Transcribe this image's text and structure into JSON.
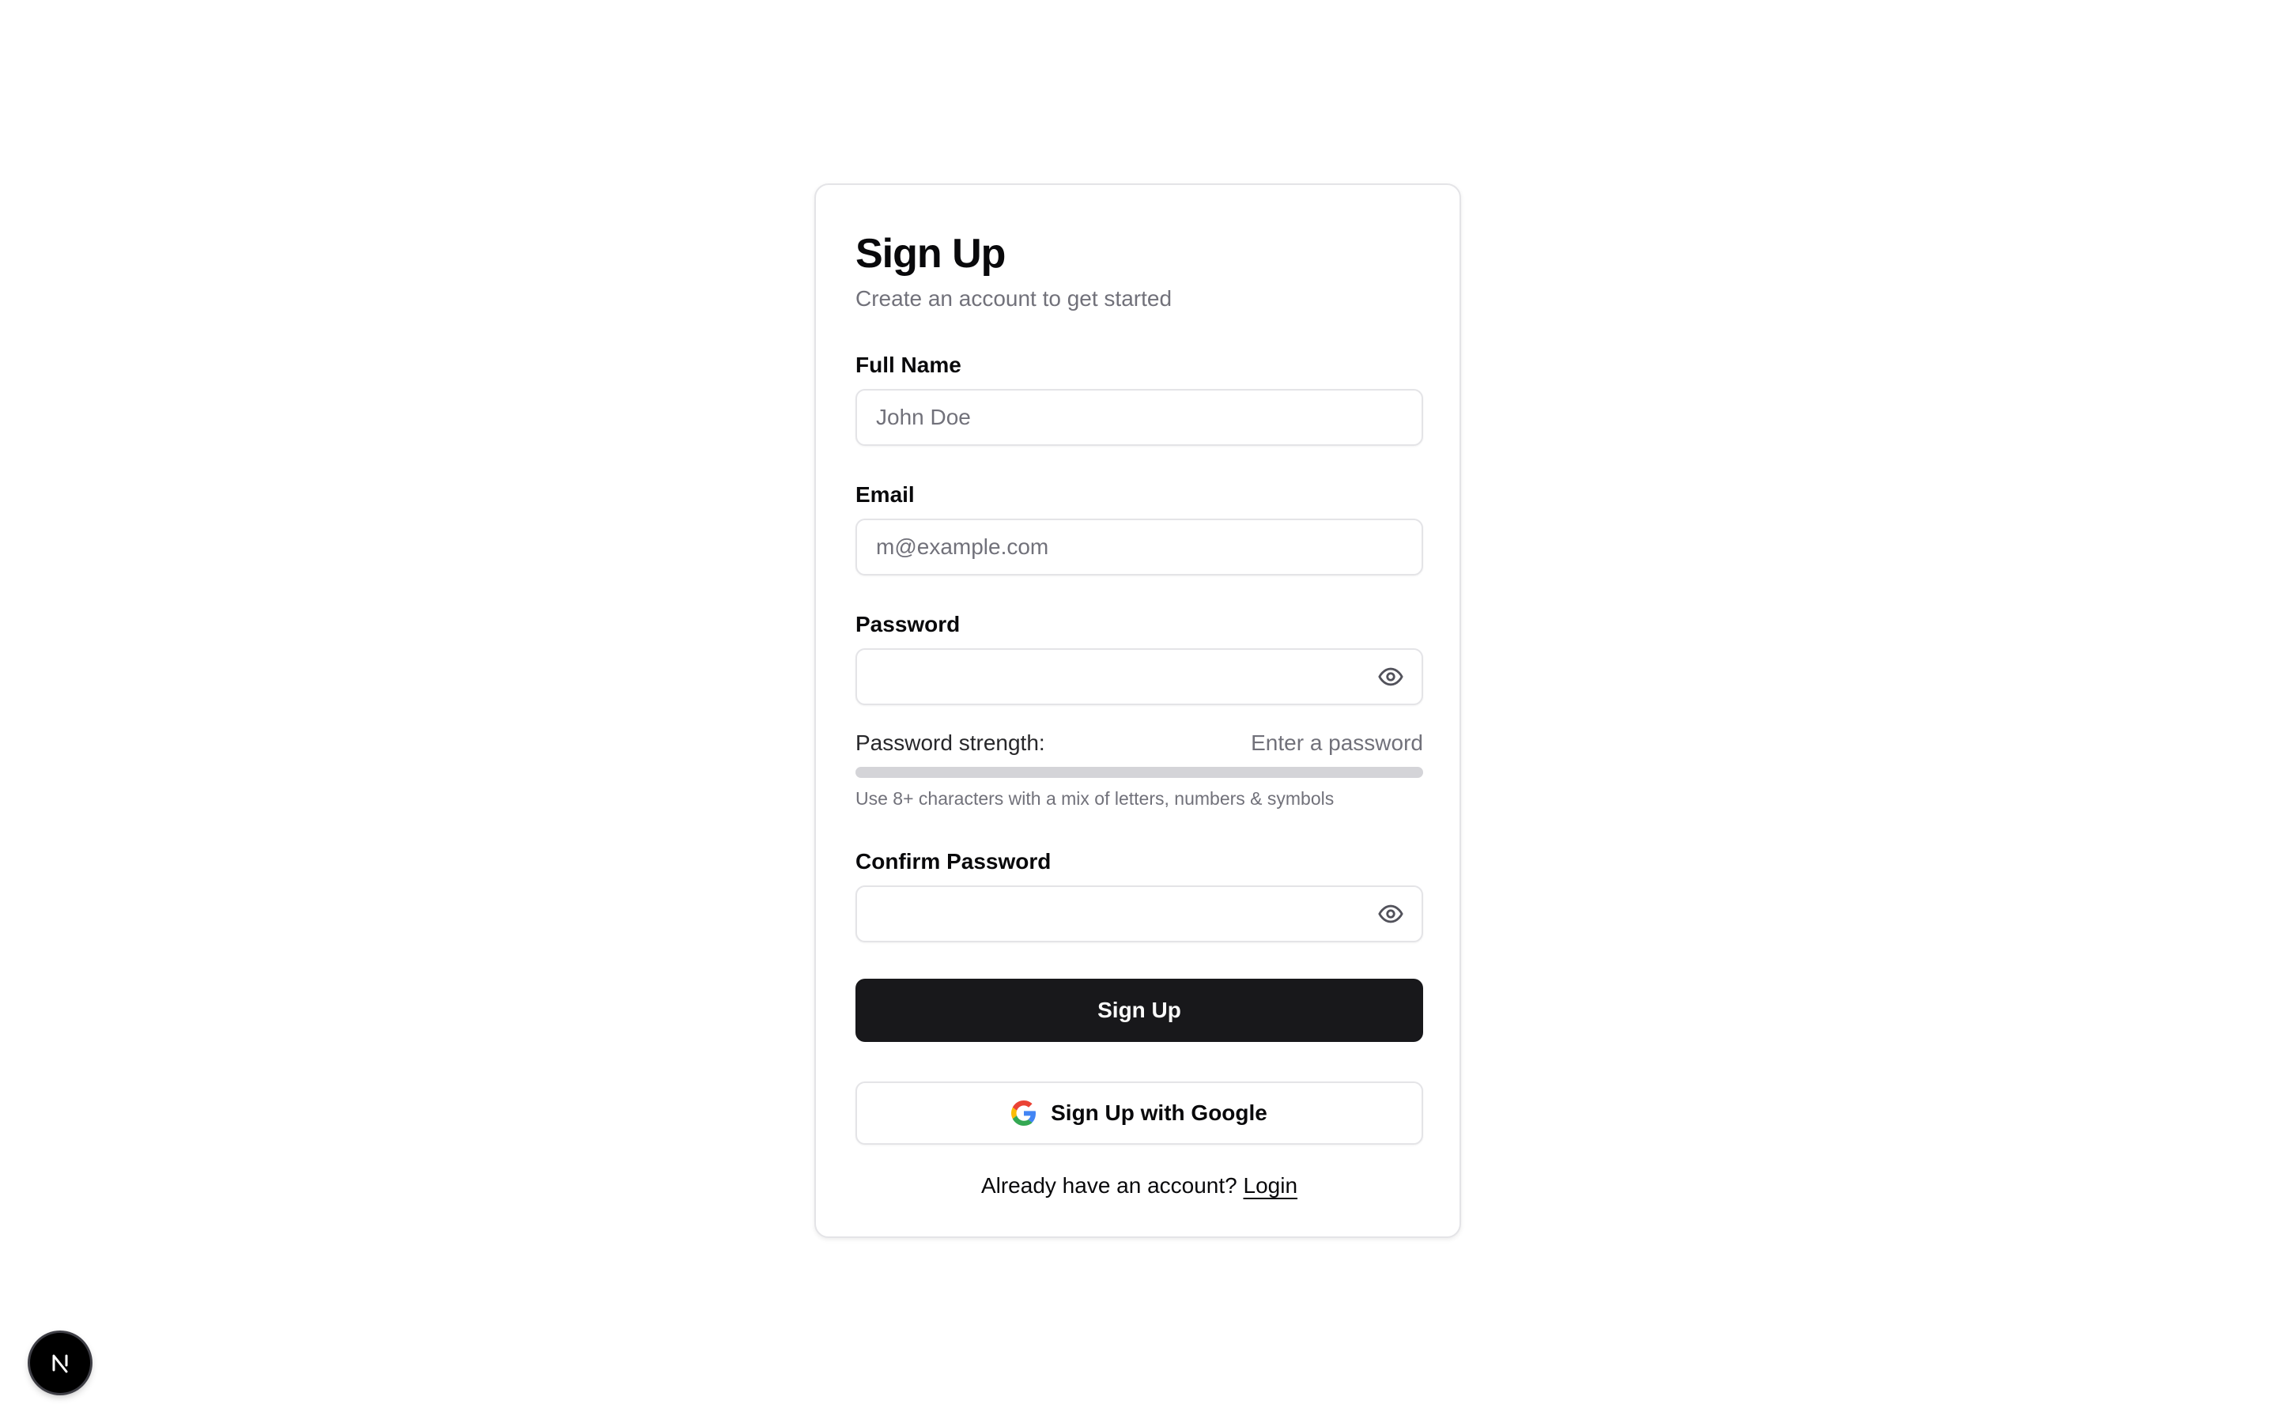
{
  "form": {
    "title": "Sign Up",
    "subtitle": "Create an account to get started",
    "full_name": {
      "label": "Full Name",
      "placeholder": "John Doe",
      "value": ""
    },
    "email": {
      "label": "Email",
      "placeholder": "m@example.com",
      "value": ""
    },
    "password": {
      "label": "Password",
      "placeholder": "",
      "value": "",
      "toggle_icon": "eye-icon"
    },
    "strength": {
      "label": "Password strength:",
      "status": "Enter a password",
      "level": 0,
      "hint": "Use 8+ characters with a mix of letters, numbers & symbols"
    },
    "confirm_password": {
      "label": "Confirm Password",
      "placeholder": "",
      "value": "",
      "toggle_icon": "eye-icon"
    },
    "submit_label": "Sign Up",
    "google_label": "Sign Up with Google",
    "login_prompt": "Already have an account?",
    "login_link": "Login"
  },
  "dev_badge": {
    "icon": "nextjs-logo-icon",
    "letter": "N"
  },
  "colors": {
    "primary_button": "#18181b",
    "muted_text": "#71717a",
    "border": "#e4e4e7",
    "strength_track": "#d4d4d8"
  }
}
